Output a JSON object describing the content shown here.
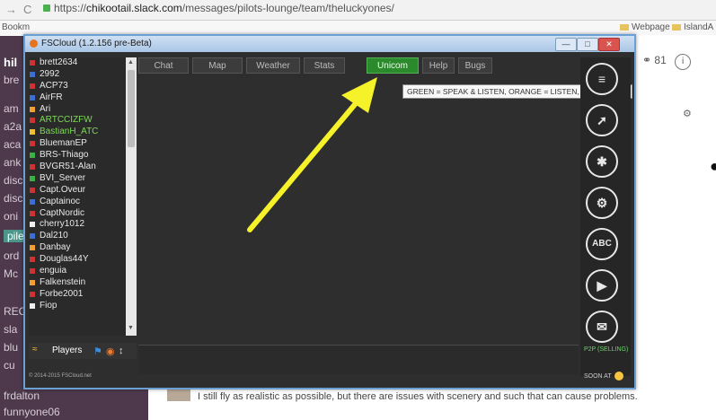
{
  "browser": {
    "url_prefix": "https://",
    "url_host": "chikootail.slack.com",
    "url_path": "/messages/pilots-lounge/team/theluckyones/",
    "bookmark_left": "Bookm",
    "bookmark_right1": "Webpage",
    "bookmark_right2": "IslandA"
  },
  "slack": {
    "sidebar_items": [
      "hil",
      "bre",
      "am",
      "a2a",
      "aca",
      "ank",
      "disc",
      "disc",
      "oni",
      "pile",
      "ord",
      "Mc",
      "REC",
      "sla",
      "blu",
      "cu",
      "frdalton",
      "funnyone06"
    ],
    "header_count": "81",
    "message": "I still fly as realistic as possible, but there are issues with scenery and such that can cause problems."
  },
  "fscloud": {
    "title": "FSCloud (1.2.156 pre-Beta)",
    "tabs": [
      "Chat",
      "Map",
      "Weather",
      "Stats",
      "Unicom",
      "Help",
      "Bugs"
    ],
    "active_tab": "Unicom",
    "tooltip": "GREEN = SPEAK & LISTEN, ORANGE = LISTEN, GRAY = OFF.",
    "players": [
      {
        "name": "brett2634",
        "color": "#e8e8e8",
        "flag": "#c33"
      },
      {
        "name": "2992",
        "color": "#e8e8e8",
        "flag": "#3a6fd1"
      },
      {
        "name": "ACP73",
        "color": "#e8e8e8",
        "flag": "#c33"
      },
      {
        "name": "AirFR",
        "color": "#e8e8e8",
        "flag": "#3a6fd1"
      },
      {
        "name": "Ari",
        "color": "#e8e8e8",
        "flag": "#f0a030"
      },
      {
        "name": "ARTCCIZFW",
        "color": "#7ed957",
        "flag": "#c33"
      },
      {
        "name": "BastianH_ATC",
        "color": "#7ed957",
        "flag": "#f0c030"
      },
      {
        "name": "BluemanEP",
        "color": "#e8e8e8",
        "flag": "#c33"
      },
      {
        "name": "BRS-Thiago",
        "color": "#e8e8e8",
        "flag": "#3cb043"
      },
      {
        "name": "BVGR51-Alan",
        "color": "#e8e8e8",
        "flag": "#c33"
      },
      {
        "name": "BVI_Server",
        "color": "#e8e8e8",
        "flag": "#3cb043"
      },
      {
        "name": "Capt.Oveur",
        "color": "#e8e8e8",
        "flag": "#c33"
      },
      {
        "name": "Captainoc",
        "color": "#e8e8e8",
        "flag": "#3a6fd1"
      },
      {
        "name": "CaptNordic",
        "color": "#e8e8e8",
        "flag": "#c33"
      },
      {
        "name": "cherry1012",
        "color": "#e8e8e8",
        "flag": "#eee"
      },
      {
        "name": "Dal210",
        "color": "#e8e8e8",
        "flag": "#3a6fd1"
      },
      {
        "name": "Danbay",
        "color": "#e8e8e8",
        "flag": "#f0a030"
      },
      {
        "name": "Douglas44Y",
        "color": "#e8e8e8",
        "flag": "#c33"
      },
      {
        "name": "enguia",
        "color": "#e8e8e8",
        "flag": "#c33"
      },
      {
        "name": "Falkenstein",
        "color": "#e8e8e8",
        "flag": "#f0a030"
      },
      {
        "name": "Forbe2001",
        "color": "#e8e8e8",
        "flag": "#c33"
      },
      {
        "name": "Fiop",
        "color": "#e8e8e8",
        "flag": "#eee"
      }
    ],
    "bottom_label": "Players",
    "footer": "© 2014-2015 FSCloud.net",
    "p2p": "P2P (SELLING)",
    "soon": "SOON AT"
  },
  "colors": {
    "active_tab": "#2b8a2b",
    "arrow": "#f5f22a",
    "window_border": "#6aa0d4"
  }
}
